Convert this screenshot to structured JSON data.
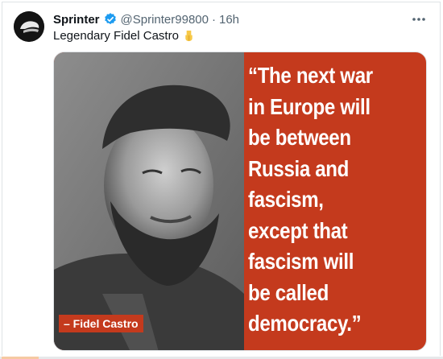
{
  "post": {
    "author_name": "Sprinter",
    "handle": "@Sprinter99800",
    "separator": "·",
    "time": "16h",
    "text": "Legendary Fidel Castro",
    "more_icon": "more-horizontal-icon",
    "verified_icon": "verified-badge-icon",
    "emoji_icon": "pointing-down-hand-icon"
  },
  "image": {
    "quote_lines": [
      "“The next war",
      "in Europe will",
      "be between",
      "Russia and",
      "fascism,",
      "except that",
      "fascism will",
      "be called",
      "democracy.”"
    ],
    "caption": "– Fidel Castro",
    "background_color": "#c43a1d"
  },
  "colors": {
    "verified": "#1d9bf0",
    "secondary_text": "#536471",
    "primary_text": "#0f1419"
  }
}
